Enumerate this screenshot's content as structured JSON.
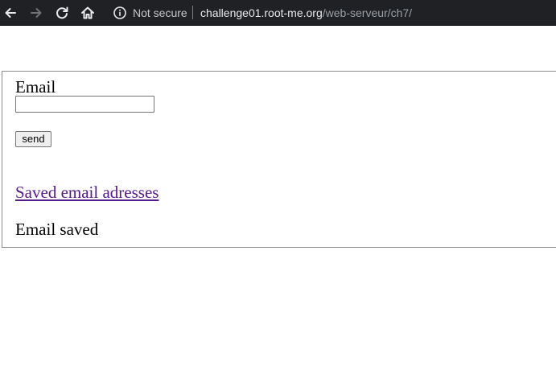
{
  "browser": {
    "security_label": "Not secure",
    "url_host": "challenge01.root-me.org",
    "url_path": "/web-serveur/ch7/",
    "icons": [
      "back-arrow-icon",
      "forward-arrow-icon",
      "reload-icon",
      "home-icon",
      "info-icon"
    ],
    "colors": {
      "toolbar_bg": "#202124",
      "url_host": "#e8eaed",
      "url_path": "#9aa0a6"
    }
  },
  "form": {
    "email_label": "Email",
    "email_value": "",
    "email_placeholder": "",
    "send_label": "send"
  },
  "page": {
    "saved_link_label": "Saved email adresses",
    "status_text": "Email saved",
    "colors": {
      "link_visited": "#551a8b"
    }
  }
}
